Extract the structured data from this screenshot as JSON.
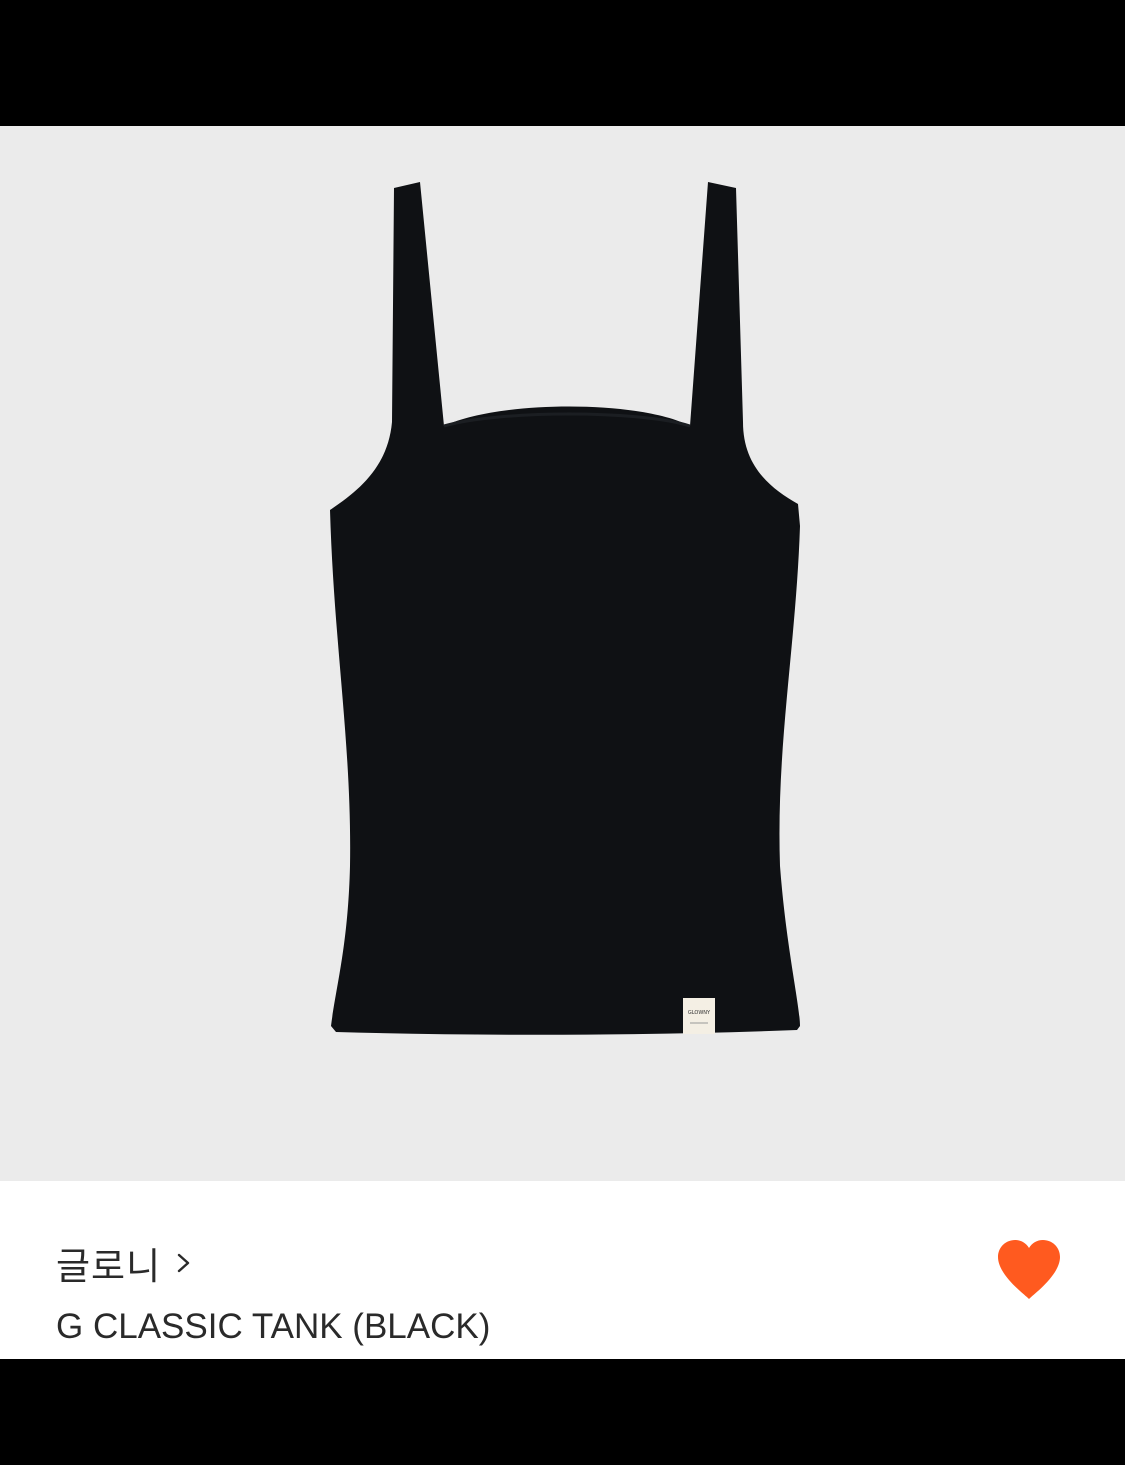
{
  "colors": {
    "image_background": "#ebebeb",
    "garment": "#0f1114",
    "like_heart": "#ff5a1f",
    "text": "#2a2a2a"
  },
  "product": {
    "image_alt": "G CLASSIC TANK (BLACK)",
    "tag_text": "GLOWNY",
    "brand": "글로니",
    "name": "G CLASSIC TANK (BLACK)",
    "liked": true
  },
  "icons": {
    "brand_link": "chevron-right-icon",
    "like": "heart-filled-icon"
  }
}
